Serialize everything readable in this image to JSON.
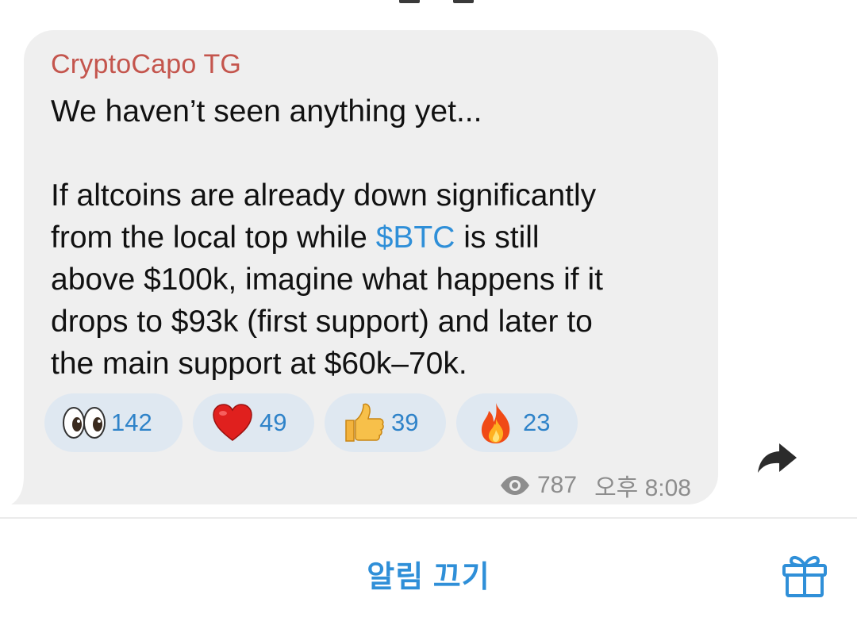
{
  "channel_post": {
    "sender": "CryptoCapo TG",
    "message": {
      "line1": "We haven’t seen anything yet...",
      "line2": "If altcoins are already down significantly",
      "line3_before": "from the local top while ",
      "line3_cashtag": "$BTC",
      "line3_after": " is still",
      "line4": "above $100k, imagine what happens if it",
      "line5": "drops to $93k (first support) and later to",
      "line6": "the main support at $60k–70k."
    },
    "reactions": [
      {
        "emoji": "eyes-icon",
        "count": "142"
      },
      {
        "emoji": "red-heart-icon",
        "count": "49"
      },
      {
        "emoji": "thumbs-up-icon",
        "count": "39"
      },
      {
        "emoji": "fire-icon",
        "count": "23"
      }
    ],
    "views": "787",
    "time": "오후 8:08"
  },
  "bottom_bar": {
    "mute_label": "알림 끄기"
  },
  "colors": {
    "sender": "#c4554d",
    "accent": "#2f8fd8",
    "bubble": "#efefef",
    "reaction_bg": "#dfe8f1",
    "meta": "#8d8d8d"
  }
}
